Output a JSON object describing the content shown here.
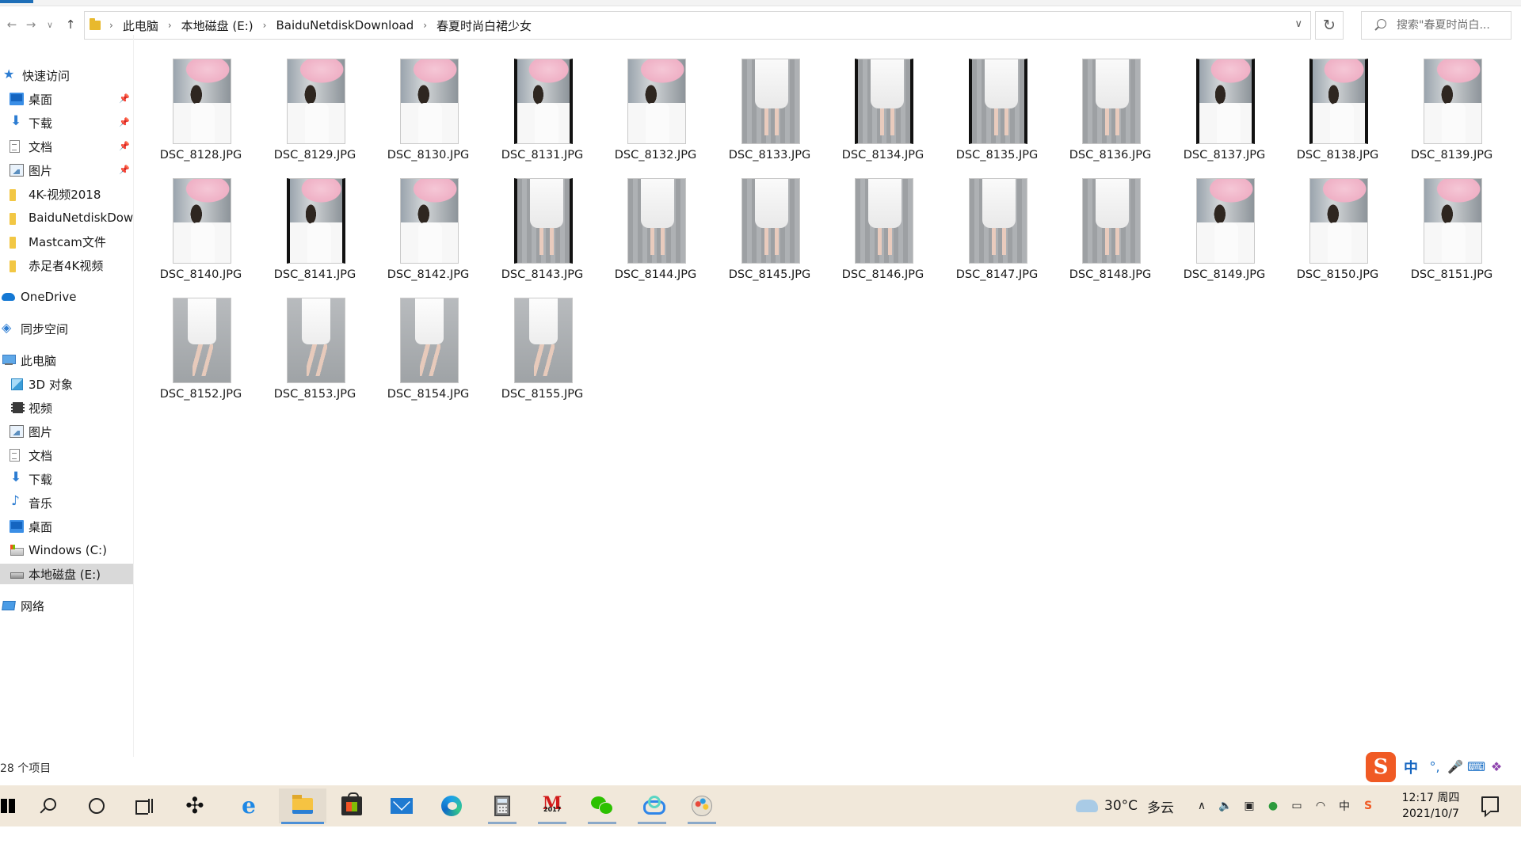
{
  "address": {
    "crumbs": [
      "此电脑",
      "本地磁盘 (E:)",
      "BaiduNetdiskDownload",
      "春夏时尚白裙少女"
    ],
    "search_placeholder": "搜索\"春夏时尚白..."
  },
  "nav": {
    "quick_access": "快速访问",
    "quick_items": [
      "桌面",
      "下载",
      "文档",
      "图片",
      "4K-视频2018",
      "BaiduNetdiskDow",
      "Mastcam文件",
      "赤足者4K视频"
    ],
    "onedrive": "OneDrive",
    "sync_space": "同步空间",
    "this_pc": "此电脑",
    "pc_items": [
      "3D 对象",
      "视频",
      "图片",
      "文档",
      "下载",
      "音乐",
      "桌面",
      "Windows (C:)",
      "本地磁盘 (E:)"
    ],
    "network": "网络"
  },
  "files": [
    "DSC_8128.JPG",
    "DSC_8129.JPG",
    "DSC_8130.JPG",
    "DSC_8131.JPG",
    "DSC_8132.JPG",
    "DSC_8133.JPG",
    "DSC_8134.JPG",
    "DSC_8135.JPG",
    "DSC_8136.JPG",
    "DSC_8137.JPG",
    "DSC_8138.JPG",
    "DSC_8139.JPG",
    "DSC_8140.JPG",
    "DSC_8141.JPG",
    "DSC_8142.JPG",
    "DSC_8143.JPG",
    "DSC_8144.JPG",
    "DSC_8145.JPG",
    "DSC_8146.JPG",
    "DSC_8147.JPG",
    "DSC_8148.JPG",
    "DSC_8149.JPG",
    "DSC_8150.JPG",
    "DSC_8151.JPG",
    "DSC_8152.JPG",
    "DSC_8153.JPG",
    "DSC_8154.JPG",
    "DSC_8155.JPG"
  ],
  "status": {
    "item_count": "28 个项目"
  },
  "ime": {
    "mode": "中",
    "logo": "S"
  },
  "taskbar": {
    "weather_temp": "30°C",
    "weather_desc": "多云",
    "ime_tray": "中",
    "time": "12:17 周四",
    "date": "2021/10/7",
    "m_app_year": "2017"
  },
  "colors": {
    "taskbar_bg": "#f1e8da",
    "accent": "#1f6fb8",
    "selected_bg": "#d9d9d9"
  }
}
